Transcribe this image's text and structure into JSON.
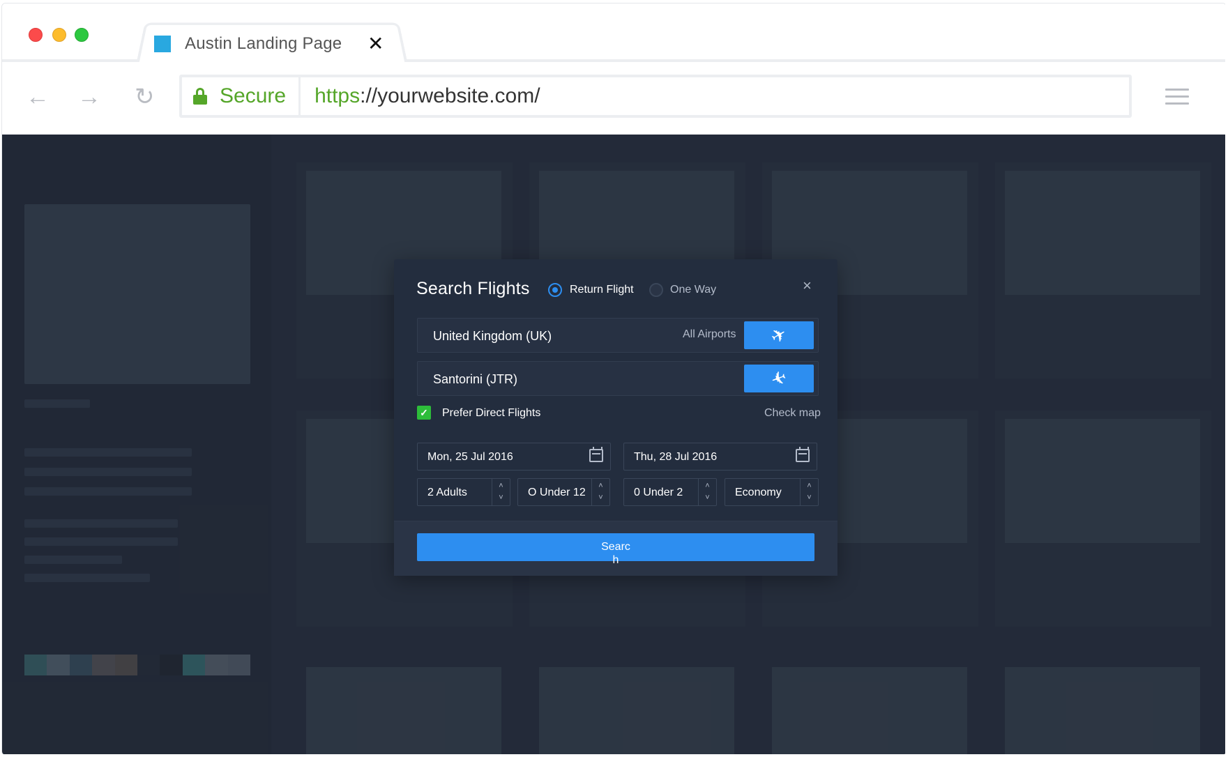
{
  "browser": {
    "tab_title": "Austin Landing Page",
    "tab_close": "✕",
    "nav": {
      "back": "←",
      "forward": "→",
      "reload": "↻"
    },
    "secure_label": "Secure",
    "url_scheme": "https",
    "url_rest": "://yourwebsite.com/"
  },
  "colors": {
    "accent": "#2d8ef0",
    "secure_green": "#55a629",
    "check_green": "#2dbd3a",
    "modal_bg": "#232d3e",
    "backdrop": "#2b3444"
  },
  "modal": {
    "title": "Search Flights",
    "trip_options": [
      {
        "label": "Return Flight",
        "selected": true
      },
      {
        "label": "One Way",
        "selected": false
      }
    ],
    "close": "×",
    "from": {
      "value": "United Kingdom (UK)",
      "airports_label": "All Airports",
      "icon": "departure-plane-icon"
    },
    "to": {
      "value": "Santorini (JTR)",
      "icon": "arrival-plane-icon"
    },
    "direct_flights": {
      "label": "Prefer Direct Flights",
      "checked": true,
      "mark": "✓"
    },
    "check_map": "Check map",
    "depart_date": "Mon, 25 Jul 2016",
    "return_date": "Thu, 28 Jul 2016",
    "steppers": [
      {
        "value": "2 Adults"
      },
      {
        "value": "O Under 12"
      },
      {
        "value": "0 Under 2"
      },
      {
        "value": "Economy"
      }
    ],
    "stepper_up": "˄",
    "stepper_down": "˅",
    "search_label": "Search"
  }
}
